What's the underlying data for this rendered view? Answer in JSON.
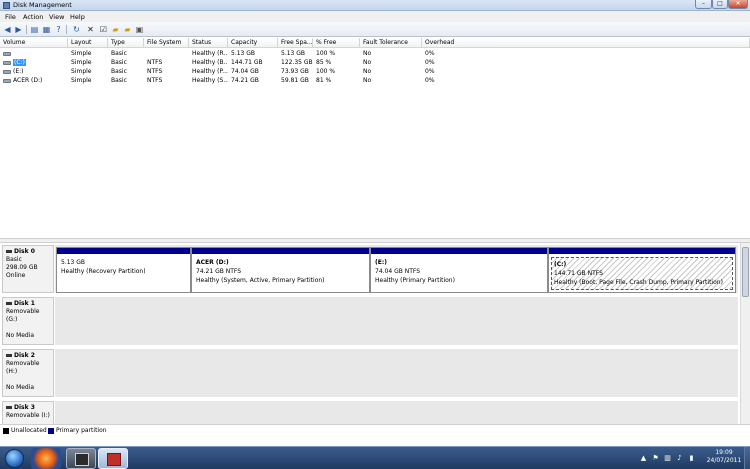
{
  "window": {
    "title": "Disk Management"
  },
  "window_buttons": {
    "minimize": "–",
    "maximize": "□",
    "close": "✕"
  },
  "menu": [
    "File",
    "Action",
    "View",
    "Help"
  ],
  "toolbar": {
    "icons": [
      "back-arrow-icon",
      "forward-arrow-icon",
      "console-tree-icon",
      "properties-icon",
      "help-icon",
      "refresh-icon",
      "delete-icon",
      "check-icon",
      "open-folder-icon",
      "explore-icon",
      "disk-properties-icon"
    ]
  },
  "columns": [
    "Volume",
    "Layout",
    "Type",
    "File System",
    "Status",
    "Capacity",
    "Free Spa...",
    "% Free",
    "Fault Tolerance",
    "Overhead"
  ],
  "volumes": [
    {
      "name": "",
      "layout": "Simple",
      "type": "Basic",
      "fs": "",
      "status": "Healthy (R...",
      "capacity": "5.13 GB",
      "free": "5.13 GB",
      "pct": "100 %",
      "fault": "No",
      "overhead": "0%"
    },
    {
      "name": "(C:)",
      "layout": "Simple",
      "type": "Basic",
      "fs": "NTFS",
      "status": "Healthy (B...",
      "capacity": "144.71 GB",
      "free": "122.35 GB",
      "pct": "85 %",
      "fault": "No",
      "overhead": "0%"
    },
    {
      "name": "(E:)",
      "layout": "Simple",
      "type": "Basic",
      "fs": "NTFS",
      "status": "Healthy (P...",
      "capacity": "74.04 GB",
      "free": "73.93 GB",
      "pct": "100 %",
      "fault": "No",
      "overhead": "0%"
    },
    {
      "name": "ACER (D:)",
      "layout": "Simple",
      "type": "Basic",
      "fs": "NTFS",
      "status": "Healthy (S...",
      "capacity": "74.21 GB",
      "free": "59.81 GB",
      "pct": "81 %",
      "fault": "No",
      "overhead": "0%"
    }
  ],
  "disks": [
    {
      "name": "Disk 0",
      "type": "Basic",
      "size": "298.09 GB",
      "state": "Online",
      "partitions": [
        {
          "name": "",
          "size": "5.13 GB",
          "status": "Healthy (Recovery Partition)"
        },
        {
          "name": "ACER  (D:)",
          "size": "74.21 GB NTFS",
          "status": "Healthy (System, Active, Primary Partition)"
        },
        {
          "name": "(E:)",
          "size": "74.04 GB NTFS",
          "status": "Healthy (Primary Partition)"
        },
        {
          "name": "(C:)",
          "size": "144.71 GB NTFS",
          "status": "Healthy (Boot, Page File, Crash Dump, Primary Partition)"
        }
      ]
    },
    {
      "name": "Disk 1",
      "type": "Removable (G:)",
      "size": "",
      "state": "No Media"
    },
    {
      "name": "Disk 2",
      "type": "Removable (H:)",
      "size": "",
      "state": "No Media"
    },
    {
      "name": "Disk 3",
      "type": "Removable (I:)",
      "size": "",
      "state": ""
    }
  ],
  "legend": [
    {
      "label": "Unallocated",
      "color": "#000000"
    },
    {
      "label": "Primary partition",
      "color": "#00008b"
    }
  ],
  "taskbar": {
    "apps": [
      "firefox-icon",
      "internet-explorer-icon",
      "disk-management-icon"
    ],
    "tray_arrow": "▲",
    "clock_time": "19:09",
    "clock_date": "24/07/2011"
  }
}
